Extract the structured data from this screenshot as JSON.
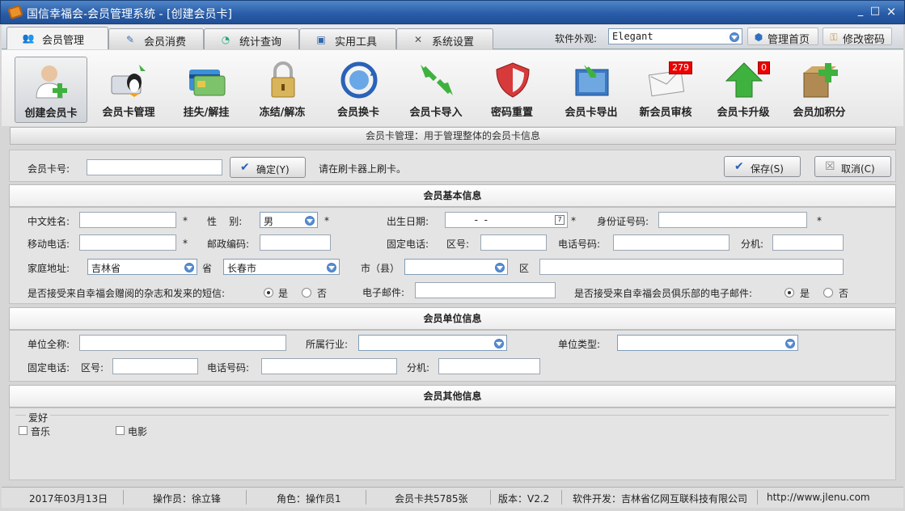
{
  "window": {
    "title": "国信幸福会-会员管理系统 - [创建会员卡]",
    "min": "_",
    "max": "□",
    "close": "×"
  },
  "tabs": [
    {
      "label": "会员管理",
      "icon": "users-icon"
    },
    {
      "label": "会员消费",
      "icon": "broom-icon"
    },
    {
      "label": "统计查询",
      "icon": "chart-icon"
    },
    {
      "label": "实用工具",
      "icon": "tools-icon"
    },
    {
      "label": "系统设置",
      "icon": "settings-icon"
    }
  ],
  "skin": {
    "label": "软件外观:",
    "value": "Elegant"
  },
  "top_links": {
    "home": "管理首页",
    "password": "修改密码"
  },
  "toolbar": [
    {
      "label": "创建会员卡",
      "icon": "create-card-icon"
    },
    {
      "label": "会员卡管理",
      "icon": "card-manage-icon"
    },
    {
      "label": "挂失/解挂",
      "icon": "report-loss-icon"
    },
    {
      "label": "冻结/解冻",
      "icon": "lock-icon"
    },
    {
      "label": "会员换卡",
      "icon": "swap-card-icon"
    },
    {
      "label": "会员卡导入",
      "icon": "import-icon"
    },
    {
      "label": "密码重置",
      "icon": "shield-icon"
    },
    {
      "label": "会员卡导出",
      "icon": "export-icon"
    },
    {
      "label": "新会员审核",
      "icon": "mail-icon",
      "badge": "279"
    },
    {
      "label": "会员卡升级",
      "icon": "upgrade-arrow-icon",
      "badge": "0"
    },
    {
      "label": "会员加积分",
      "icon": "add-points-icon"
    }
  ],
  "info": "会员卡管理：用于管理整体的会员卡信息",
  "card": {
    "label": "会员卡号:",
    "value": "",
    "confirm": "确定(Y)",
    "hint": "请在刷卡器上刷卡。",
    "save": "保存(S)",
    "cancel": "取消(C)"
  },
  "basic": {
    "title": "会员基本信息",
    "name_label": "中文姓名:",
    "gender_label": "性    别:",
    "gender": "男",
    "birth_label": "出生日期:",
    "birth": "  -  -",
    "id_label": "身份证号码:",
    "mobile_label": "移动电话:",
    "postcode_label": "邮政编码:",
    "phone_label": "固定电话:",
    "area_label": "区号:",
    "phone_no_label": "电话号码:",
    "ext_label": "分机:",
    "addr_label": "家庭地址:",
    "province": "吉林省",
    "province_label": "省",
    "city": "长春市",
    "county_label": "市（县）",
    "district_label": "区",
    "sms_question": "是否接受来自幸福会赠阅的杂志和发来的短信:",
    "yes": "是",
    "no": "否",
    "email_label": "电子邮件:",
    "email_question": "是否接受来自幸福会员俱乐部的电子邮件:",
    "star": "*"
  },
  "company": {
    "title": "会员单位信息",
    "name_label": "单位全称:",
    "industry_label": "所属行业:",
    "type_label": "单位类型:",
    "phone_label": "固定电话:",
    "area_label": "区号:",
    "phone_no_label": "电话号码:",
    "ext_label": "分机:"
  },
  "other": {
    "title": "会员其他信息",
    "hobby_label": "爱好",
    "hobbies": [
      "音乐",
      "电影"
    ]
  },
  "status": {
    "date": "2017年03月13日",
    "operator": "操作员：徐立锋",
    "role": "角色：操作员1",
    "count": "会员卡共5785张",
    "version": "版本：V2.2",
    "developer": "软件开发：吉林省亿网互联科技有限公司",
    "url": "http://www.jlenu.com"
  }
}
